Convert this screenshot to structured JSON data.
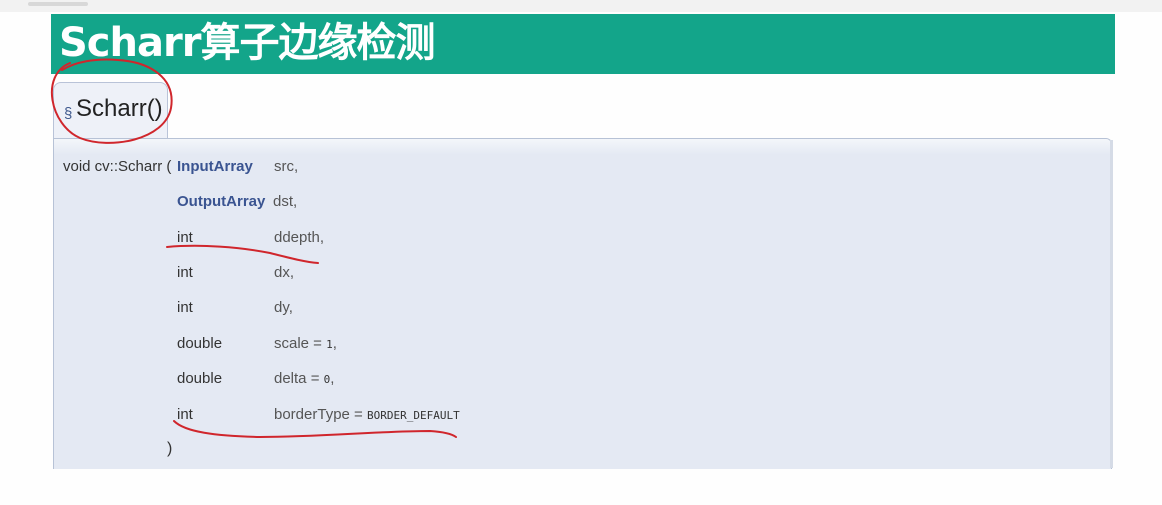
{
  "title": "Scharr算子边缘检测",
  "anchor": {
    "symbol": "§",
    "name": "Scharr()"
  },
  "prototype": {
    "prefix": "void cv::Scharr (",
    "params": [
      {
        "type": "InputArray",
        "type_link": true,
        "name": "src,",
        "default": ""
      },
      {
        "type": "OutputArray",
        "type_link": true,
        "name": "dst,",
        "default": ""
      },
      {
        "type": "int",
        "type_link": false,
        "name": "ddepth,",
        "default": ""
      },
      {
        "type": "int",
        "type_link": false,
        "name": "dx,",
        "default": ""
      },
      {
        "type": "int",
        "type_link": false,
        "name": "dy,",
        "default": ""
      },
      {
        "type": "double",
        "type_link": false,
        "name": "scale = ",
        "default": "1",
        "suffix": ","
      },
      {
        "type": "double",
        "type_link": false,
        "name": "delta = ",
        "default": "0",
        "suffix": ","
      },
      {
        "type": "int",
        "type_link": false,
        "name": "borderType = ",
        "default": "BORDER_DEFAULT",
        "suffix": ""
      }
    ],
    "close": ")"
  },
  "annotation_color": "#d0262c",
  "banner_color": "#13a58a"
}
